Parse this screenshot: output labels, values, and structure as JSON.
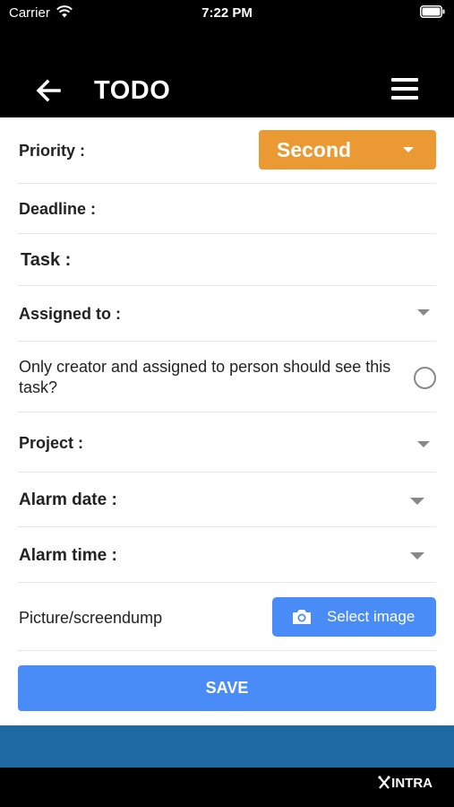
{
  "status_bar": {
    "carrier": "Carrier",
    "time": "7:22 PM"
  },
  "header": {
    "title": "TODO"
  },
  "form": {
    "priority_label": "Priority :",
    "priority_value": "Second",
    "deadline_label": "Deadline :",
    "task_label": "Task :",
    "assigned_label": "Assigned to :",
    "privacy_text": "Only creator and assigned to person should see this task?",
    "project_label": "Project :",
    "alarm_date_label": "Alarm date :",
    "alarm_time_label": "Alarm time :",
    "picture_label": "Picture/screendump",
    "select_image_label": "Select image",
    "save_label": "SAVE"
  },
  "footer": {
    "brand": "INTRA"
  },
  "colors": {
    "priority": "#eb9a33",
    "primary_button": "#4a8cf7",
    "band": "#1e69a3"
  },
  "icons": [
    "wifi-icon",
    "battery-icon",
    "back-arrow-icon",
    "hamburger-menu-icon",
    "camera-icon",
    "intra-logo-icon"
  ]
}
